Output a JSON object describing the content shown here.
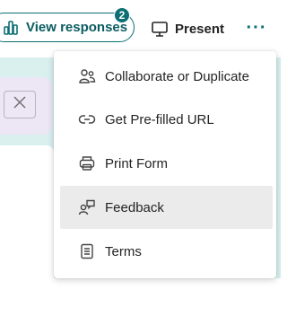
{
  "toolbar": {
    "view_responses_label": "View responses",
    "responses_count": "2",
    "present_label": "Present",
    "more_label": "···"
  },
  "menu": {
    "items": [
      {
        "label": "Collaborate or Duplicate",
        "icon": "people-icon"
      },
      {
        "label": "Get Pre-filled URL",
        "icon": "link-icon"
      },
      {
        "label": "Print Form",
        "icon": "printer-icon"
      },
      {
        "label": "Feedback",
        "icon": "feedback-icon",
        "active": true
      },
      {
        "label": "Terms",
        "icon": "document-icon"
      }
    ]
  },
  "colors": {
    "accent": "#0b6f74",
    "background": "#d9f0ef",
    "menu_hover": "#ebebeb",
    "card": "#ece6f5"
  }
}
